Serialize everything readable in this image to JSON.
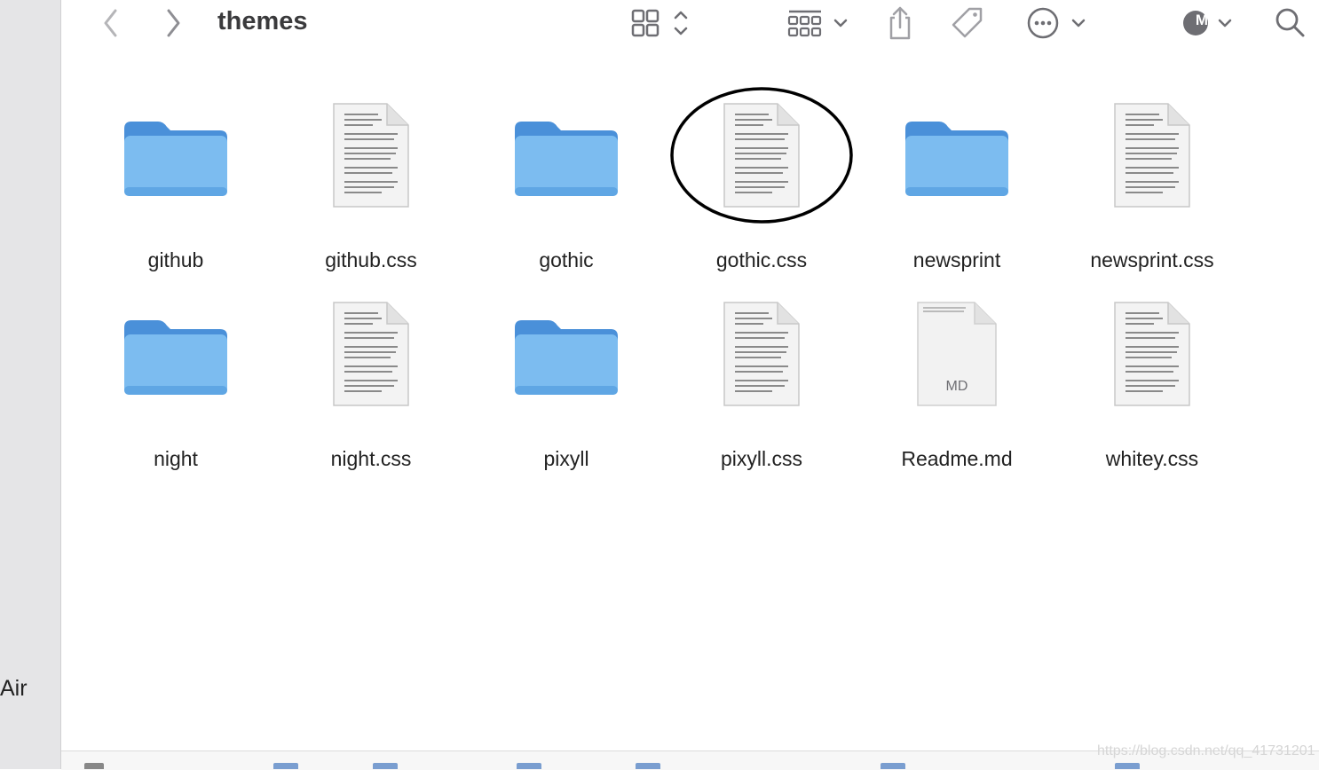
{
  "window": {
    "title": "themes"
  },
  "sidebar": {
    "partial_label": "Air"
  },
  "toolbar": {
    "back_icon": "chevron-left-icon",
    "forward_icon": "chevron-right-icon",
    "view_icon": "icon-grid-view-icon",
    "group_icon": "group-by-icon",
    "share_icon": "share-icon",
    "tag_icon": "tag-icon",
    "more_icon": "ellipsis-circle-icon",
    "account_letter": "M",
    "search_icon": "search-icon"
  },
  "files": [
    {
      "name": "github",
      "kind": "folder"
    },
    {
      "name": "github.css",
      "kind": "css"
    },
    {
      "name": "gothic",
      "kind": "folder"
    },
    {
      "name": "gothic.css",
      "kind": "css",
      "circled": true
    },
    {
      "name": "newsprint",
      "kind": "folder"
    },
    {
      "name": "newsprint.css",
      "kind": "css"
    },
    {
      "name": "night",
      "kind": "folder"
    },
    {
      "name": "night.css",
      "kind": "css"
    },
    {
      "name": "pixyll",
      "kind": "folder"
    },
    {
      "name": "pixyll.css",
      "kind": "css"
    },
    {
      "name": "Readme.md",
      "kind": "md",
      "badge": "MD"
    },
    {
      "name": "whitey.css",
      "kind": "css"
    }
  ],
  "watermark": "https://blog.csdn.net/qq_41731201",
  "colors": {
    "folder": "#5fa8e6",
    "annotation": "#000000"
  }
}
